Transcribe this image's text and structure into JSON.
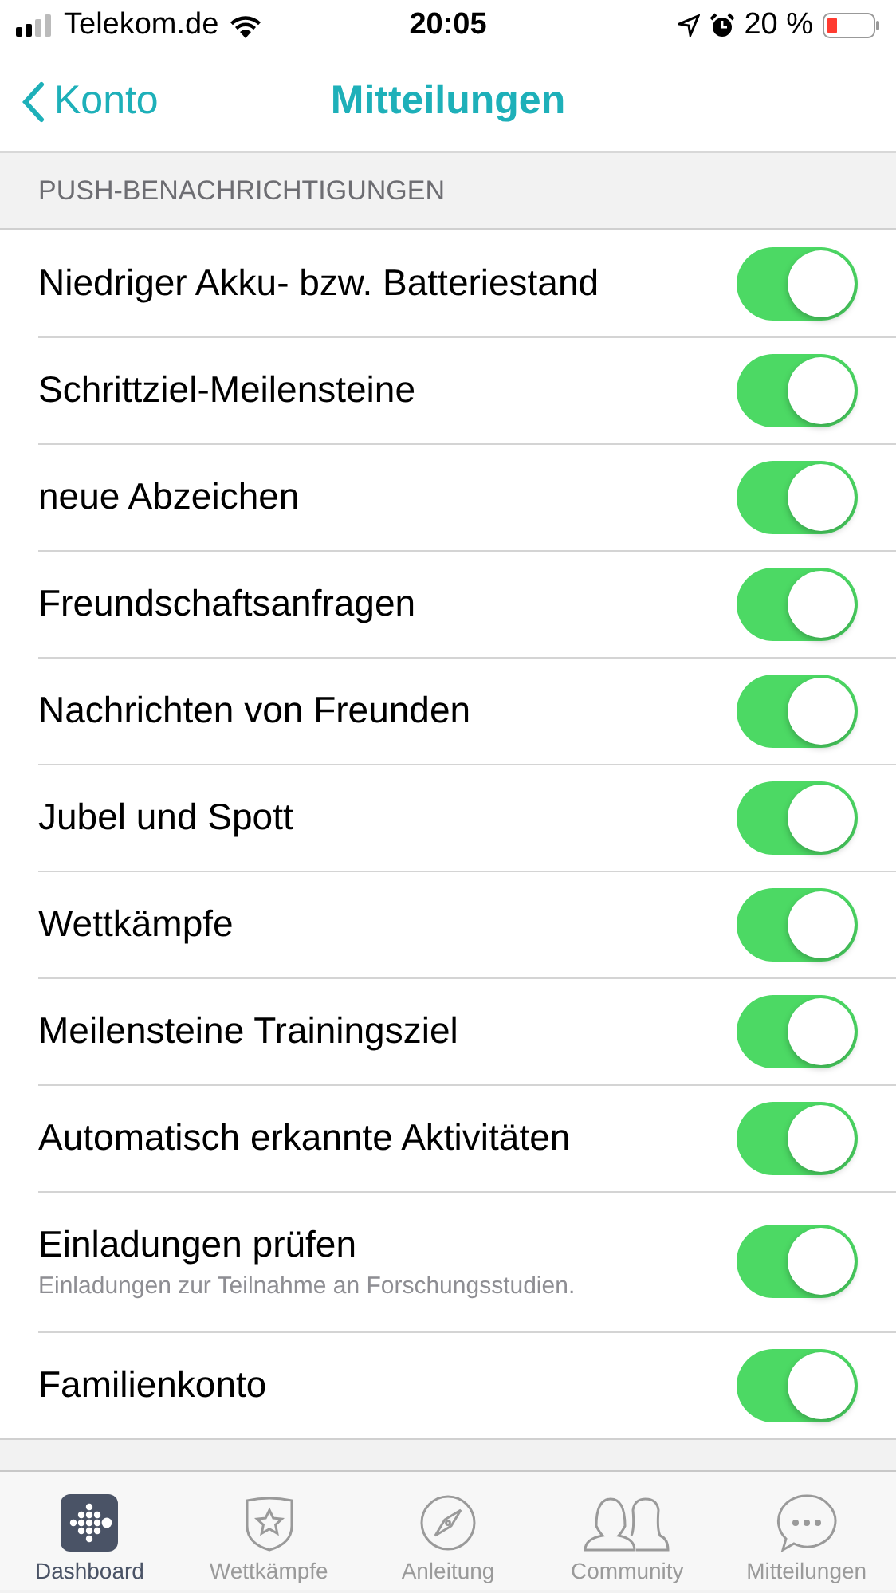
{
  "status_bar": {
    "carrier": "Telekom.de",
    "time": "20:05",
    "battery": "20 %"
  },
  "nav": {
    "back": "Konto",
    "title": "Mitteilungen"
  },
  "section": {
    "header": "PUSH-BENACHRICHTIGUNGEN"
  },
  "settings": [
    {
      "label": "Niedriger Akku- bzw. Batteriestand",
      "on": true
    },
    {
      "label": "Schrittziel-Meilensteine",
      "on": true
    },
    {
      "label": "neue Abzeichen",
      "on": true
    },
    {
      "label": "Freundschaftsanfragen",
      "on": true
    },
    {
      "label": "Nachrichten von Freunden",
      "on": true
    },
    {
      "label": "Jubel und Spott",
      "on": true
    },
    {
      "label": "Wettkämpfe",
      "on": true
    },
    {
      "label": "Meilensteine Trainingsziel",
      "on": true
    },
    {
      "label": "Automatisch erkannte Aktivitäten",
      "on": true
    },
    {
      "label": "Einladungen prüfen",
      "subtitle": "Einladungen zur Teilnahme an Forschungsstudien.",
      "on": true
    },
    {
      "label": "Familienkonto",
      "on": true
    }
  ],
  "tab_bar": [
    {
      "kind": "dashboard",
      "label": "Dashboard",
      "selected": true
    },
    {
      "kind": "challenges",
      "label": "Wettkämpfe",
      "selected": false
    },
    {
      "kind": "guide",
      "label": "Anleitung",
      "selected": false
    },
    {
      "kind": "community",
      "label": "Community",
      "selected": false
    },
    {
      "kind": "messages",
      "label": "Mitteilungen",
      "selected": false
    }
  ]
}
